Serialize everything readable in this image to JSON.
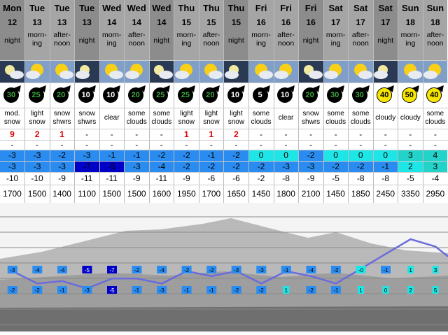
{
  "columns": [
    {
      "day": "Mon",
      "date": "12",
      "period": [
        "night"
      ],
      "sky": "night",
      "wind": "30",
      "wind_style": "green",
      "summary": [
        "mod.",
        "snow"
      ],
      "snow": "9",
      "rain": "-",
      "max": "-3",
      "min": "-3",
      "chill": "-10",
      "freeze": "1700"
    },
    {
      "day": "Tue",
      "date": "13",
      "period": [
        "morn-",
        "ing"
      ],
      "sky": "day",
      "wind": "25",
      "wind_style": "green",
      "summary": [
        "light",
        "snow"
      ],
      "snow": "2",
      "rain": "-",
      "max": "-3",
      "min": "-3",
      "chill": "-10",
      "freeze": "1500"
    },
    {
      "day": "Tue",
      "date": "13",
      "period": [
        "after-",
        "noon"
      ],
      "sky": "day",
      "wind": "20",
      "wind_style": "green",
      "summary": [
        "snow",
        "shwrs"
      ],
      "snow": "1",
      "rain": "-",
      "max": "-2",
      "min": "-3",
      "chill": "-9",
      "freeze": "1400"
    },
    {
      "day": "Tue",
      "date": "13",
      "period": [
        "night"
      ],
      "sky": "night",
      "wind": "10",
      "wind_style": "white",
      "summary": [
        "snow",
        "shwrs"
      ],
      "snow": "-",
      "rain": "-",
      "max": "-3",
      "min": "-7",
      "chill": "-11",
      "freeze": "1100"
    },
    {
      "day": "Wed",
      "date": "14",
      "period": [
        "morn-",
        "ing"
      ],
      "sky": "day",
      "wind": "10",
      "wind_style": "white",
      "summary": [
        "clear"
      ],
      "snow": "-",
      "rain": "-",
      "max": "-1",
      "min": "-5",
      "chill": "-11",
      "freeze": "1500"
    },
    {
      "day": "Wed",
      "date": "14",
      "period": [
        "after-",
        "noon"
      ],
      "sky": "day",
      "wind": "20",
      "wind_style": "green",
      "summary": [
        "some",
        "clouds"
      ],
      "snow": "-",
      "rain": "-",
      "max": "-1",
      "min": "-3",
      "chill": "-9",
      "freeze": "1500"
    },
    {
      "day": "Wed",
      "date": "14",
      "period": [
        "night"
      ],
      "sky": "night",
      "wind": "25",
      "wind_style": "green",
      "summary": [
        "some",
        "clouds"
      ],
      "snow": "-",
      "rain": "-",
      "max": "-2",
      "min": "-4",
      "chill": "-11",
      "freeze": "1600"
    },
    {
      "day": "Thu",
      "date": "15",
      "period": [
        "morn-",
        "ing"
      ],
      "sky": "day",
      "wind": "25",
      "wind_style": "green",
      "summary": [
        "light",
        "snow"
      ],
      "snow": "1",
      "rain": "-",
      "max": "-2",
      "min": "-2",
      "chill": "-9",
      "freeze": "1950"
    },
    {
      "day": "Thu",
      "date": "15",
      "period": [
        "after-",
        "noon"
      ],
      "sky": "day",
      "wind": "20",
      "wind_style": "green",
      "summary": [
        "light",
        "snow"
      ],
      "snow": "1",
      "rain": "-",
      "max": "-1",
      "min": "-2",
      "chill": "-6",
      "freeze": "1700"
    },
    {
      "day": "Thu",
      "date": "15",
      "period": [
        "night"
      ],
      "sky": "night",
      "wind": "10",
      "wind_style": "white",
      "summary": [
        "light",
        "snow"
      ],
      "snow": "2",
      "rain": "-",
      "max": "-2",
      "min": "-2",
      "chill": "-6",
      "freeze": "1650"
    },
    {
      "day": "Fri",
      "date": "16",
      "period": [
        "morn-",
        "ing"
      ],
      "sky": "day",
      "wind": "5",
      "wind_style": "white",
      "summary": [
        "some",
        "clouds"
      ],
      "snow": "-",
      "rain": "-",
      "max": "0",
      "min": "-2",
      "chill": "-2",
      "freeze": "1450"
    },
    {
      "day": "Fri",
      "date": "16",
      "period": [
        "after-",
        "noon"
      ],
      "sky": "day",
      "wind": "10",
      "wind_style": "white",
      "summary": [
        "clear"
      ],
      "snow": "-",
      "rain": "-",
      "max": "0",
      "min": "-3",
      "chill": "-8",
      "freeze": "1800"
    },
    {
      "day": "Fri",
      "date": "16",
      "period": [
        "night"
      ],
      "sky": "night",
      "wind": "20",
      "wind_style": "green",
      "summary": [
        "snow",
        "shwrs"
      ],
      "snow": "-",
      "rain": "-",
      "max": "-2",
      "min": "-3",
      "chill": "-9",
      "freeze": "2100"
    },
    {
      "day": "Sat",
      "date": "17",
      "period": [
        "morn-",
        "ing"
      ],
      "sky": "day",
      "wind": "30",
      "wind_style": "green",
      "summary": [
        "some",
        "clouds"
      ],
      "snow": "-",
      "rain": "-",
      "max": "0",
      "min": "-2",
      "chill": "-5",
      "freeze": "1450"
    },
    {
      "day": "Sat",
      "date": "17",
      "period": [
        "after-",
        "noon"
      ],
      "sky": "day",
      "wind": "30",
      "wind_style": "green",
      "summary": [
        "some",
        "clouds"
      ],
      "snow": "-",
      "rain": "-",
      "max": "0",
      "min": "-2",
      "chill": "-8",
      "freeze": "1850"
    },
    {
      "day": "Sat",
      "date": "17",
      "period": [
        "night"
      ],
      "sky": "night",
      "wind": "40",
      "wind_style": "yellow",
      "summary": [
        "cloudy"
      ],
      "snow": "-",
      "rain": "-",
      "max": "0",
      "min": "-1",
      "chill": "-8",
      "freeze": "2450"
    },
    {
      "day": "Sun",
      "date": "18",
      "period": [
        "morn-",
        "ing"
      ],
      "sky": "day",
      "wind": "50",
      "wind_style": "yellow",
      "summary": [
        "cloudy"
      ],
      "snow": "-",
      "rain": "-",
      "max": "3",
      "min": "2",
      "chill": "-5",
      "freeze": "3350"
    },
    {
      "day": "Sun",
      "date": "18",
      "period": [
        "after-",
        "noon"
      ],
      "sky": "day",
      "wind": "40",
      "wind_style": "yellow",
      "summary": [
        "some",
        "clouds"
      ],
      "snow": "-",
      "rain": "-",
      "max": "4",
      "min": "3",
      "chill": "-4",
      "freeze": "2950"
    }
  ],
  "chart_data": {
    "type": "line",
    "x": [
      "Mon 12 night",
      "Tue 13 morning",
      "Tue 13 afternoon",
      "Tue 13 night",
      "Wed 14 morning",
      "Wed 14 afternoon",
      "Wed 14 night",
      "Thu 15 morning",
      "Thu 15 afternoon",
      "Thu 15 night",
      "Fri 16 morning",
      "Fri 16 afternoon",
      "Fri 16 night",
      "Sat 17 morning",
      "Sat 17 afternoon",
      "Sat 17 night",
      "Sun 18 morning",
      "Sun 18 afternoon"
    ],
    "upper_labels": [
      "-3",
      "-4",
      "-4",
      "-5",
      "-7",
      "-2",
      "-4",
      "-2",
      "-2",
      "-3",
      "-3",
      "-1",
      "-4",
      "-2",
      "-0",
      "-1",
      "1",
      "3"
    ],
    "lower_labels": [
      "-2",
      "-2",
      "-1",
      "-3",
      "-5",
      "-1",
      "-3",
      "-1",
      "-1",
      "-2",
      "-2",
      "1",
      "-2",
      "-1",
      "1",
      "0",
      "2",
      "5"
    ],
    "line_values": [
      "2200",
      "1700",
      "1800",
      "1500",
      "1900",
      "1900",
      "1700",
      "2200",
      "2000",
      "2200",
      "1700",
      "2200",
      "2000",
      "1700",
      "2300",
      "2900",
      "3500",
      "3200"
    ]
  },
  "colors": {
    "header_day": "#a5a5a5",
    "header_night": "#8c8c8c",
    "line": "#6b6bdc"
  }
}
